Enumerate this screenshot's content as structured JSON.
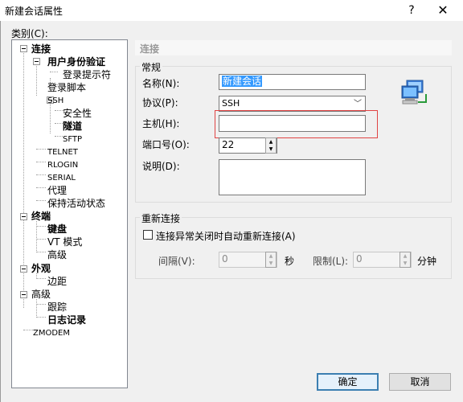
{
  "window": {
    "title": "新建会话属性",
    "help_icon": "?",
    "close_icon": "✕"
  },
  "category_label": "类别(C):",
  "tree": {
    "connection": "连接",
    "user_auth": "用户身份验证",
    "login_prompts": "登录提示符",
    "login_script": "登录脚本",
    "ssh": "SSH",
    "security": "安全性",
    "tunneling": "隧道",
    "sftp": "SFTP",
    "telnet": "TELNET",
    "rlogin": "RLOGIN",
    "serial": "SERIAL",
    "proxy": "代理",
    "keepalive": "保持活动状态",
    "terminal": "终端",
    "keyboard": "键盘",
    "vt_mode": "VT 模式",
    "advanced": "高级",
    "appearance": "外观",
    "margins": "边距",
    "advanced2": "高级",
    "trace": "跟踪",
    "logging": "日志记录",
    "zmodem": "ZMODEM"
  },
  "panel": {
    "header": "连接",
    "general_group": "常规",
    "name_label": "名称(N):",
    "name_value": "新建会话",
    "protocol_label": "协议(P):",
    "protocol_value": "SSH",
    "host_label": "主机(H):",
    "host_value": "",
    "port_label": "端口号(O):",
    "port_value": "22",
    "desc_label": "说明(D):",
    "desc_value": "",
    "reconnect_group": "重新连接",
    "auto_reconnect_label": "连接异常关闭时自动重新连接(A)",
    "interval_label": "间隔(V):",
    "interval_value": "0",
    "seconds_unit": "秒",
    "limit_label": "限制(L):",
    "limit_value": "0",
    "minutes_unit": "分钟"
  },
  "buttons": {
    "ok": "确定",
    "cancel": "取消"
  }
}
